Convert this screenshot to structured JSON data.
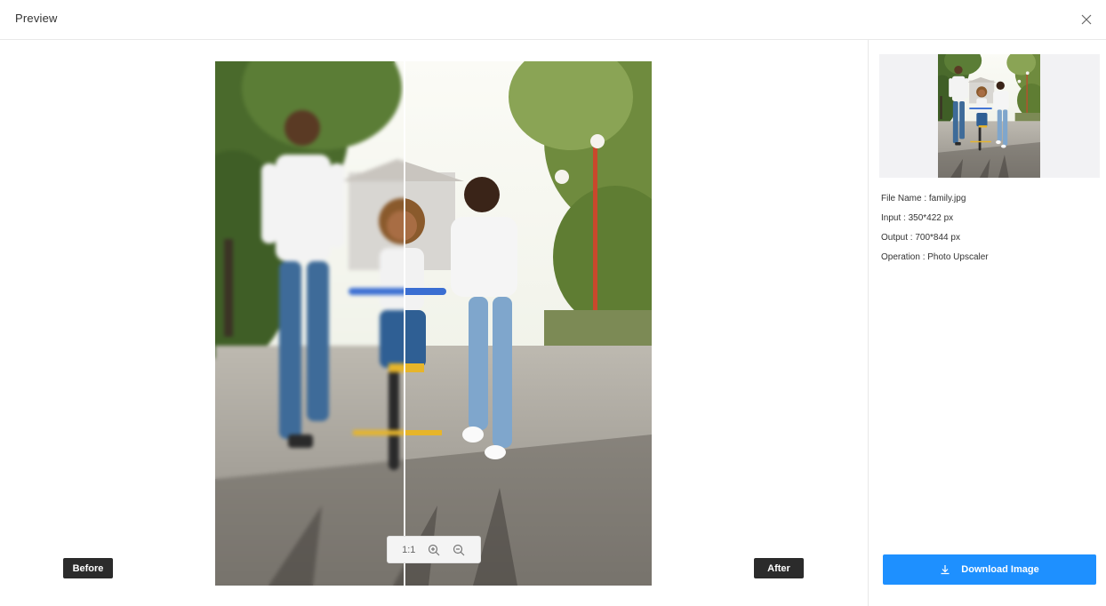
{
  "header": {
    "title": "Preview"
  },
  "zoom": {
    "ratio_label": "1:1"
  },
  "compare": {
    "before_label": "Before",
    "after_label": "After"
  },
  "file_info": {
    "file_name": "File Name : family.jpg",
    "input": "Input : 350*422 px",
    "output": "Output : 700*844 px",
    "operation": "Operation : Photo Upscaler"
  },
  "actions": {
    "download_label": "Download Image"
  },
  "icons": {
    "close": "close-icon",
    "zoom_in": "zoom-in-icon",
    "zoom_out": "zoom-out-icon",
    "download": "download-icon"
  },
  "colors": {
    "accent": "#1e90ff",
    "tag_bg": "#2b2b2b"
  }
}
